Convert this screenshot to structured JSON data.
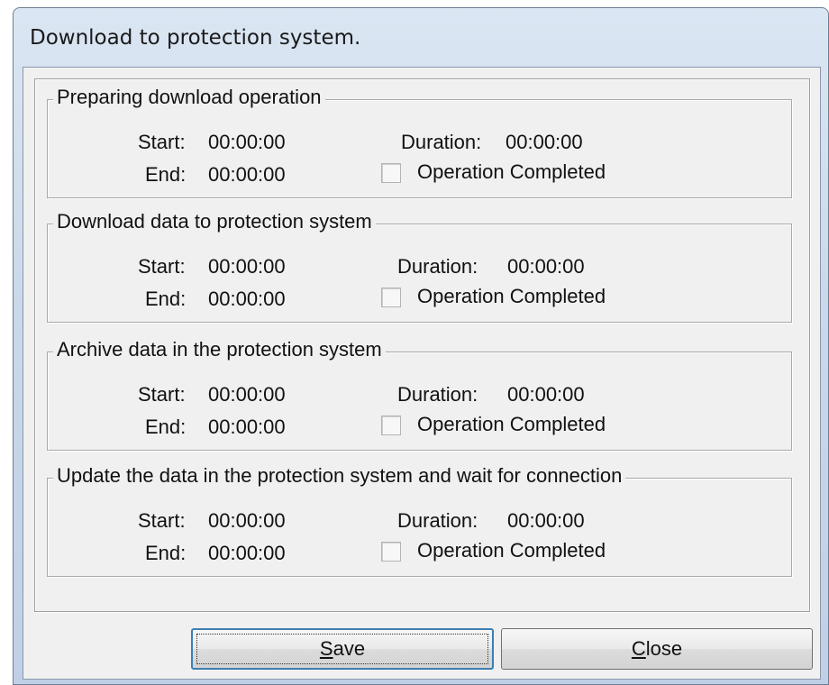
{
  "window": {
    "title": "Download to protection system."
  },
  "labels": {
    "start": "Start:",
    "end": "End:",
    "duration": "Duration:",
    "completed": "Operation Completed"
  },
  "steps": [
    {
      "title": "Preparing download operation",
      "start": "00:00:00",
      "end": "00:00:00",
      "duration": "00:00:00",
      "completed": false
    },
    {
      "title": "Download data to protection system",
      "start": "00:00:00",
      "end": "00:00:00",
      "duration": "00:00:00",
      "completed": false
    },
    {
      "title": "Archive data in the protection system",
      "start": "00:00:00",
      "end": "00:00:00",
      "duration": "00:00:00",
      "completed": false
    },
    {
      "title": "Update the data in the protection system and wait for connection",
      "start": "00:00:00",
      "end": "00:00:00",
      "duration": "00:00:00",
      "completed": false
    }
  ],
  "buttons": {
    "save": {
      "mnemonic": "S",
      "rest": "ave"
    },
    "close": {
      "mnemonic": "C",
      "rest": "lose"
    }
  }
}
